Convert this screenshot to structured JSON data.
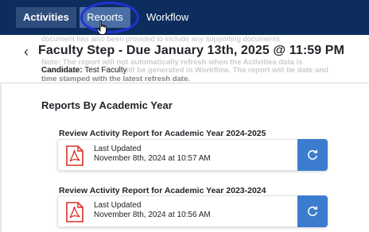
{
  "nav": {
    "tabs": [
      {
        "label": "Activities"
      },
      {
        "label": "Reports"
      },
      {
        "label": "Workflow"
      }
    ]
  },
  "header": {
    "ghost_line1": "document has also been provided to include any supporting documents",
    "title": "Faculty Step - Due January 13th, 2025 @ 11:59 PM",
    "ghost_line2": "Note: The report will not automatically refresh when the Activities data is",
    "ghost_line3": "updated. A new report will be generated in Workflow. The report will be date and",
    "ghost_line4": "time stamped with the latest refresh date.",
    "candidate_label": "Candidate:",
    "candidate_name": "Test Faculty"
  },
  "section": {
    "title": "Reports By Academic Year"
  },
  "reports": [
    {
      "heading": "Review Activity Report for Academic Year 2024-2025",
      "updated_label": "Last Updated",
      "updated_value": "November 8th, 2024 at 10:57 AM"
    },
    {
      "heading": "Review Activity Report for Academic Year 2023-2024",
      "updated_label": "Last Updated",
      "updated_value": "November 8th, 2024 at 10:56 AM"
    }
  ],
  "colors": {
    "nav_bg": "#0d2d5e",
    "active_tab": "#4a6fa6",
    "refresh_button": "#3b7ccf",
    "pdf_red": "#d93025",
    "highlight_ring": "#1f33d6"
  },
  "icons": {
    "back": "chevron-left-icon",
    "file": "pdf-file-icon",
    "refresh": "refresh-icon",
    "cursor": "hand-pointer-icon"
  }
}
